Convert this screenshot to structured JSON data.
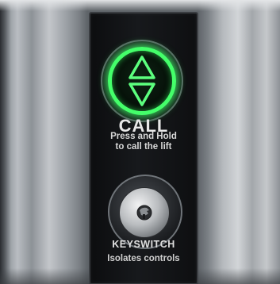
{
  "panel": {
    "call_label": "CALL",
    "instruction_line1": "Press and Hold",
    "instruction_line2": "to call the lift",
    "keyswitch_label": "KEYSWITCH",
    "keyswitch_sublabel": "Isolates controls"
  },
  "icons": {
    "call_button": "up-down-arrows-icon",
    "keyswitch": "key-slot-icon"
  },
  "colors": {
    "glow": "#44ff6a",
    "panel": "#121416",
    "wall": "#9fa4a9"
  }
}
